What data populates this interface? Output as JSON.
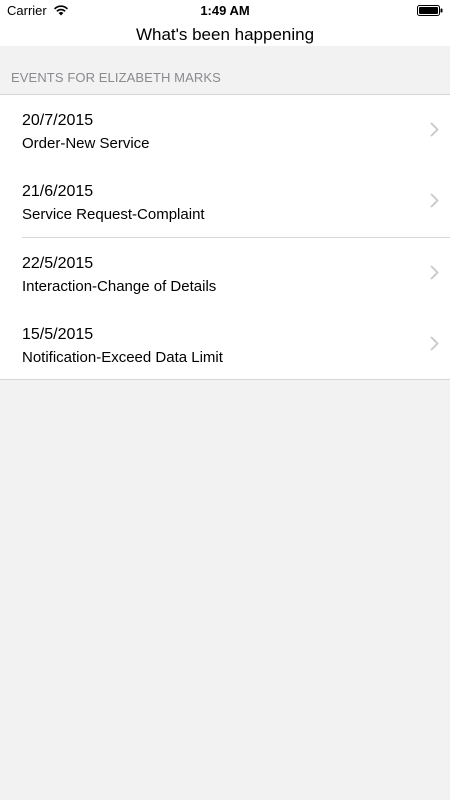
{
  "status_bar": {
    "carrier": "Carrier",
    "time": "1:49 AM"
  },
  "nav": {
    "title": "What's been happening"
  },
  "section": {
    "header": "EVENTS FOR ELIZABETH MARKS"
  },
  "events": [
    {
      "date": "20/7/2015",
      "title": "Order-New Service"
    },
    {
      "date": "21/6/2015",
      "title": "Service Request-Complaint"
    },
    {
      "date": "22/5/2015",
      "title": "Interaction-Change of Details"
    },
    {
      "date": "15/5/2015",
      "title": "Notification-Exceed Data Limit"
    }
  ]
}
